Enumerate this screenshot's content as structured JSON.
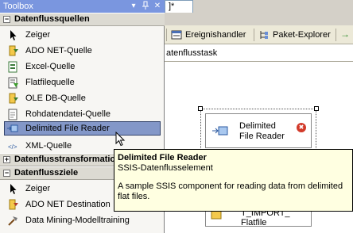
{
  "toolbox": {
    "title": "Toolbox",
    "pin_glyph": "▾",
    "close_glyph": "✕",
    "sections": [
      {
        "name": "Datenflussquellen",
        "expanded": "−"
      },
      {
        "name": "Datenflusstransformationen",
        "expanded": "+"
      },
      {
        "name": "Datenflussziele",
        "expanded": "−"
      }
    ],
    "sources": [
      "Zeiger",
      "ADO NET-Quelle",
      "Excel-Quelle",
      "Flatfilequelle",
      "OLE DB-Quelle",
      "Rohdatendatei-Quelle",
      "Delimited File Reader",
      "XML-Quelle"
    ],
    "destinations": [
      "Zeiger",
      "ADO NET Destination",
      "Data Mining-Modelltraining"
    ]
  },
  "document": {
    "tab_fragment": "]*",
    "toolbar": {
      "event_handler": "Ereignishandler",
      "package_explorer": "Paket-Explorer",
      "arrow": "→"
    },
    "subbar_text": "atenflusstask"
  },
  "canvas": {
    "component_label_1": "Delimited",
    "component_label_2": "File Reader",
    "component2_label_1": "T_IMPORT_",
    "component2_label_2": "Flatfile",
    "error_glyph": "✖"
  },
  "tooltip": {
    "title": "Delimited File Reader",
    "subtitle": "SSIS-Datenflusselement",
    "description": "A sample SSIS component for reading data from delimited flat files."
  },
  "colors": {
    "selection": "#8397c8",
    "tooltip_bg": "#ffffe1",
    "titlebar": "#7a96df"
  }
}
